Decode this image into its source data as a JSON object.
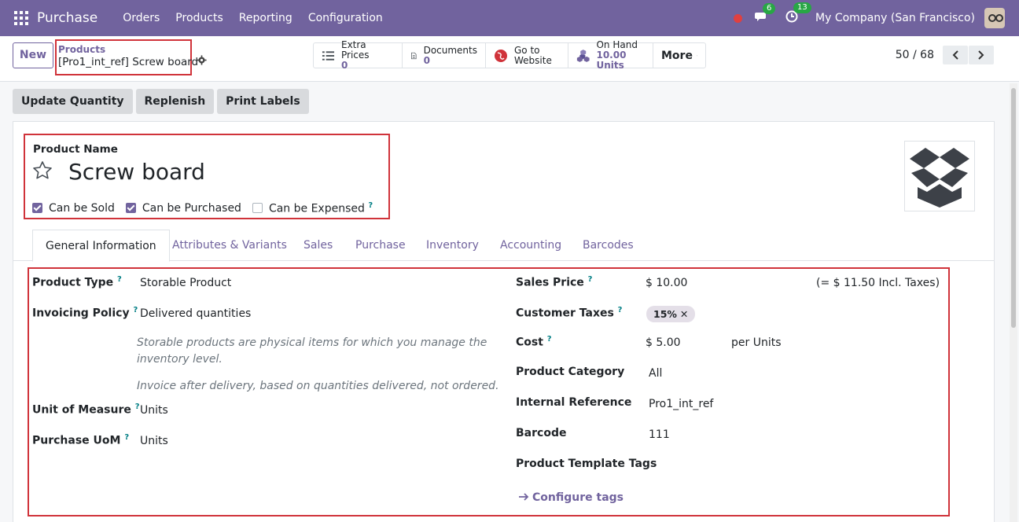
{
  "nav": {
    "app": "Purchase",
    "menus": [
      "Orders",
      "Products",
      "Reporting",
      "Configuration"
    ],
    "chat_count": "6",
    "activity_count": "13",
    "company": "My Company (San Francisco)"
  },
  "control": {
    "new_label": "New",
    "breadcrumb_parent": "Products",
    "breadcrumb_current": "[Pro1_int_ref] Screw board",
    "smart_buttons": [
      {
        "label": "Extra Prices",
        "value": "0"
      },
      {
        "label": "Documents",
        "value": "0"
      },
      {
        "label": "Go to",
        "value": "Website"
      },
      {
        "label": "On Hand",
        "value": "10.00 Units"
      }
    ],
    "more_label": "More",
    "pager": "50 / 68"
  },
  "actions": [
    "Update Quantity",
    "Replenish",
    "Print Labels"
  ],
  "product": {
    "name_label": "Product Name",
    "name": "Screw board",
    "can_be_sold": "Can be Sold",
    "can_be_purchased": "Can be Purchased",
    "can_be_expensed": "Can be Expensed"
  },
  "tabs": [
    "General Information",
    "Attributes & Variants",
    "Sales",
    "Purchase",
    "Inventory",
    "Accounting",
    "Barcodes"
  ],
  "left_fields": {
    "product_type_label": "Product Type",
    "product_type": "Storable Product",
    "invoicing_policy_label": "Invoicing Policy",
    "invoicing_policy": "Delivered quantities",
    "note1": "Storable products are physical items for which you manage the inventory level.",
    "note2": "Invoice after delivery, based on quantities delivered, not ordered.",
    "uom_label": "Unit of Measure",
    "uom": "Units",
    "purchase_uom_label": "Purchase UoM",
    "purchase_uom": "Units"
  },
  "right_fields": {
    "sales_price_label": "Sales Price",
    "sales_price": "$ 10.00",
    "incl_taxes": "(= $ 11.50 Incl. Taxes)",
    "customer_taxes_label": "Customer Taxes",
    "tax_tag": "15%",
    "cost_label": "Cost",
    "cost": "$ 5.00",
    "cost_unit": "per Units",
    "category_label": "Product Category",
    "category": "All",
    "internal_ref_label": "Internal Reference",
    "internal_ref": "Pro1_int_ref",
    "barcode_label": "Barcode",
    "barcode": "111",
    "tags_label": "Product Template Tags",
    "configure_tags": "Configure tags"
  },
  "colors": {
    "brand": "#71639e",
    "highlight": "#d0333a"
  }
}
